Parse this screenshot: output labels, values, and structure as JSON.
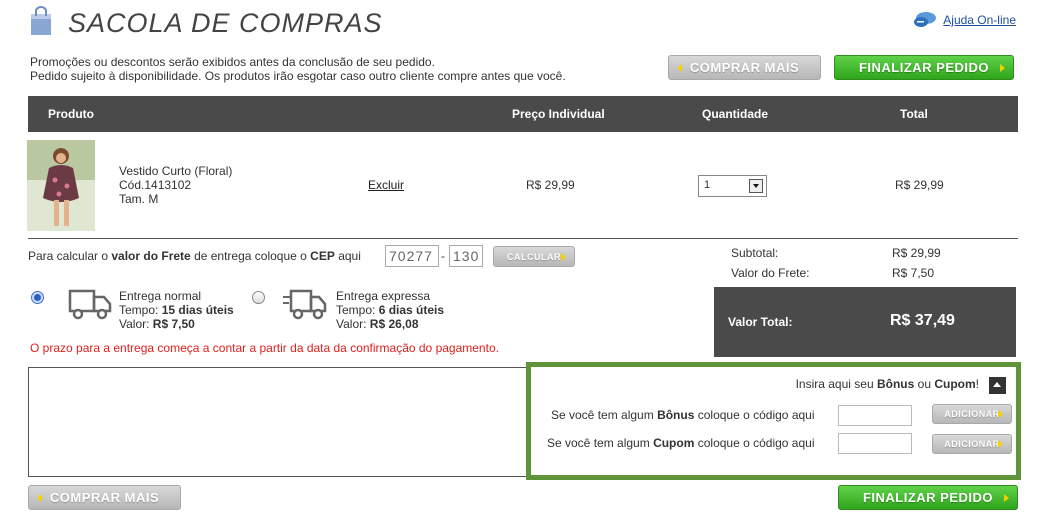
{
  "header": {
    "title": "SACOLA DE COMPRAS",
    "help_link": "Ajuda On-line"
  },
  "notices": [
    "Promoções ou descontos serão exibidos antes da conclusão de seu pedido.",
    "Pedido sujeito à disponibilidade. Os produtos irão esgotar caso outro cliente compre antes que você."
  ],
  "buttons": {
    "continue_shopping": "COMPRAR MAIS",
    "checkout": "FINALIZAR PEDIDO",
    "calculate": "CALCULAR",
    "add": "ADICIONAR"
  },
  "table": {
    "headers": [
      "Produto",
      "Preço Individual",
      "Quantidade",
      "Total"
    ],
    "item": {
      "name": "Vestido Curto (Floral)",
      "code": "Cód.1413102",
      "size": "Tam. M",
      "delete": "Excluir",
      "unit_price": "R$ 29,99",
      "quantity": "1",
      "total": "R$ 29,99"
    }
  },
  "freight": {
    "label_pre": "Para calcular o ",
    "label_bold1": "valor do Frete",
    "label_mid": " de entrega coloque o ",
    "label_bold2": "CEP",
    "label_post": " aqui",
    "cep_part1": "70277",
    "cep_part2": "130",
    "dash": "-"
  },
  "delivery": {
    "normal": {
      "title": "Entrega normal",
      "time_label": "Tempo: ",
      "time_value": "15 dias úteis",
      "price_label": "Valor: ",
      "price_value": "R$ 7,50",
      "selected": true
    },
    "express": {
      "title": "Entrega expressa",
      "time_label": "Tempo: ",
      "time_value": "6 dias úteis",
      "price_label": "Valor: ",
      "price_value": "R$ 26,08",
      "selected": false
    },
    "deadline_note": "O prazo para a entrega começa a contar a partir da data da confirmação do pagamento."
  },
  "summary": {
    "subtotal_label": "Subtotal:",
    "subtotal_value": "R$ 29,99",
    "freight_label": "Valor do Frete:",
    "freight_value": "R$ 7,50",
    "total_label": "Valor Total:",
    "total_value": "R$ 37,49"
  },
  "coupon": {
    "head_pre": "Insira aqui seu ",
    "head_bonus": "Bônus",
    "head_mid": " ou ",
    "head_cupom": "Cupom",
    "head_post": "!",
    "bonus_pre": "Se você tem algum ",
    "bonus_bold": "Bônus",
    "bonus_post": " coloque o código aqui",
    "cupom_pre": "Se você tem algum ",
    "cupom_bold": "Cupom",
    "cupom_post": " coloque o código aqui"
  },
  "colors": {
    "accent_green": "#2fa51c",
    "dark_header": "#4a4a4a",
    "warning_red": "#e0201c",
    "coupon_border": "#5f9438",
    "link_blue": "#1f4e9a"
  }
}
